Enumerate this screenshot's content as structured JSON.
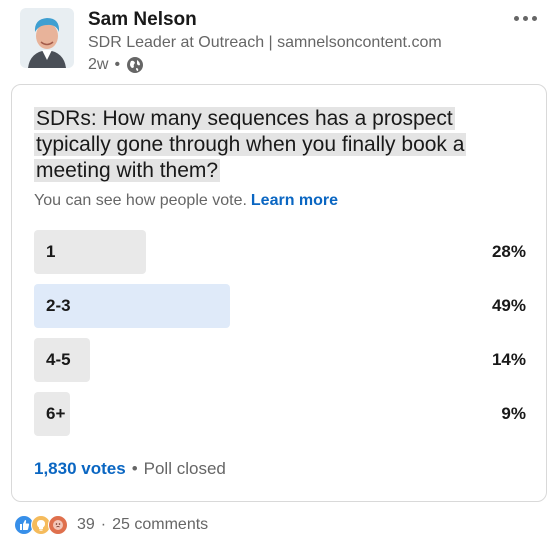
{
  "post": {
    "author_name": "Sam Nelson",
    "author_subtitle": "SDR Leader at Outreach | samnelsoncontent.com",
    "age": "2w",
    "visibility_icon": "globe-icon",
    "more_icon": "ellipsis-icon"
  },
  "poll": {
    "question": "SDRs: How many sequences has a prospect typically gone through when you finally book a meeting with them?",
    "vote_note": "You can see how people vote.",
    "learn_more": "Learn more",
    "options": [
      {
        "label": "1",
        "percent": "28%",
        "fraction": 0.28,
        "selected": false
      },
      {
        "label": "2-3",
        "percent": "49%",
        "fraction": 0.49,
        "selected": true
      },
      {
        "label": "4-5",
        "percent": "14%",
        "fraction": 0.14,
        "selected": false
      },
      {
        "label": "6+",
        "percent": "9%",
        "fraction": 0.09,
        "selected": false
      }
    ],
    "votes": "1,830 votes",
    "status": "Poll closed"
  },
  "social": {
    "reactions": [
      "like-icon",
      "insightful-icon",
      "curious-icon"
    ],
    "reaction_count": "39",
    "comments": "25 comments",
    "colors": {
      "like": "#378fe9",
      "insightful": "#f5bb5c",
      "curious": "#df704d"
    }
  },
  "colors": {
    "accent": "#0a66c2",
    "selected_bar": "#dfeaf9",
    "bar": "#e9e9e9"
  }
}
